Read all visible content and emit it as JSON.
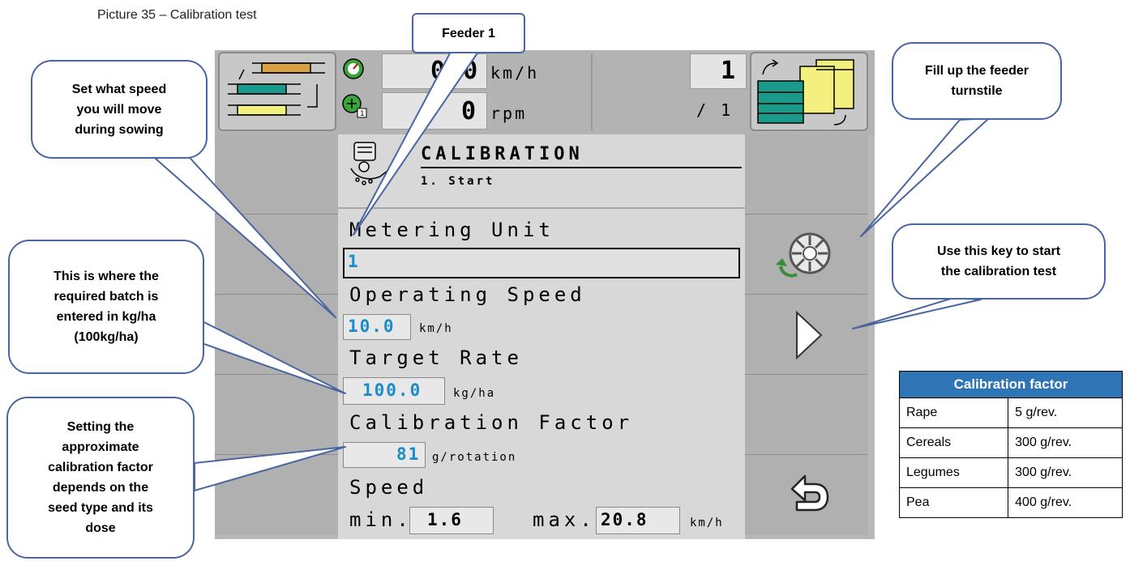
{
  "caption": "Picture 35 – Calibration test",
  "screen": {
    "top": {
      "speed_value": "0.0",
      "speed_unit": "km/h",
      "rpm_value": "0",
      "rpm_unit": "rpm",
      "counter_value": "1",
      "counter_sub": "/ 1",
      "rpm_badge": "1"
    },
    "panel": {
      "title": "CALIBRATION",
      "step": "1. Start",
      "metering_label": "Metering Unit",
      "metering_value": "1",
      "speed_label": "Operating Speed",
      "speed_value": "10.0",
      "speed_unit": "km/h",
      "rate_label": "Target Rate",
      "rate_value": "100.0",
      "rate_unit": "kg/ha",
      "factor_label": "Calibration Factor",
      "factor_value": "81",
      "factor_unit": "g/rotation",
      "limits_label": "Speed",
      "min_label": "min.",
      "min_value": "1.6",
      "max_label": "max.",
      "max_value": "20.8",
      "limits_unit": "km/h"
    }
  },
  "callouts": {
    "feeder": "Feeder 1",
    "speed": "Set what speed\nyou will move\nduring sowing",
    "batch": "This is where the\nrequired batch is\nentered in kg/ha\n(100kg/ha)",
    "factor": "Setting the\napproximate\ncalibration factor\ndepends on the\nseed type and its\ndose",
    "fill": "Fill up the feeder\nturnstile",
    "start": "Use this key to start\nthe calibration test"
  },
  "table": {
    "header": "Calibration factor",
    "rows": [
      {
        "seed": "Rape",
        "factor": "5 g/rev."
      },
      {
        "seed": "Cereals",
        "factor": "300 g/rev."
      },
      {
        "seed": "Legumes",
        "factor": "300 g/rev."
      },
      {
        "seed": "Pea",
        "factor": "400 g/rev."
      }
    ]
  },
  "colors": {
    "value_blue": "#1a8ccc",
    "callout_border": "#4a66a0",
    "table_header": "#2f75b5",
    "teal": "#1a9a8a",
    "yellow": "#f4f080",
    "orange": "#d9a040"
  }
}
